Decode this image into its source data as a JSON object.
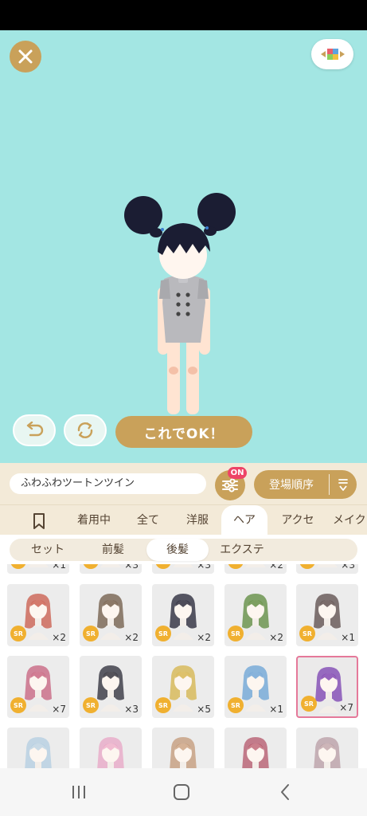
{
  "header": {
    "close_icon": "close-icon",
    "palette_icon": "color-blocks-icon"
  },
  "actions": {
    "undo_icon": "undo-icon",
    "reset_icon": "refresh-icon",
    "ok_label": "これでOK！"
  },
  "item_bar": {
    "item_name": "ふわふわツートンツイン",
    "filter_badge": "ON",
    "sort_label": "登場順序"
  },
  "tabs": [
    {
      "label": "着用中"
    },
    {
      "label": "全て"
    },
    {
      "label": "洋服"
    },
    {
      "label": "ヘア",
      "active": true
    },
    {
      "label": "アクセ"
    },
    {
      "label": "メイク"
    }
  ],
  "subtabs": [
    {
      "label": "セット"
    },
    {
      "label": "前髪"
    },
    {
      "label": "後髪",
      "active": true
    },
    {
      "label": "エクステ"
    }
  ],
  "grid": {
    "top_row_counts": [
      "×1",
      "×3",
      "×3",
      "×2",
      "×3"
    ],
    "items": [
      {
        "rarity": "SR",
        "count": "×2",
        "hair": "#c95a4a"
      },
      {
        "rarity": "SR",
        "count": "×2",
        "hair": "#6f5a45"
      },
      {
        "rarity": "SR",
        "count": "×2",
        "hair": "#222233"
      },
      {
        "rarity": "SR",
        "count": "×2",
        "hair": "#5c8a3c"
      },
      {
        "rarity": "SR",
        "count": "×1",
        "hair": "#5a4a48"
      },
      {
        "rarity": "SR",
        "count": "×7",
        "hair": "#c7607d"
      },
      {
        "rarity": "SR",
        "count": "×3",
        "hair": "#2a2a35"
      },
      {
        "rarity": "SR",
        "count": "×5",
        "hair": "#d6b44a"
      },
      {
        "rarity": "SR",
        "count": "×1",
        "hair": "#6aa3d6"
      },
      {
        "rarity": "SR",
        "count": "×7",
        "hair": "#7a3fb0",
        "selected": true
      }
    ],
    "bottom_row_hair": [
      "#9fc3de",
      "#e88cb8",
      "#b57a4c",
      "#a01f3a",
      "#a5808a"
    ]
  },
  "colors": {
    "stage_bg": "#a3e6e3",
    "gold": "#c9a15a",
    "badge_red": "#ee4466",
    "sr_badge": "#f0b030"
  }
}
